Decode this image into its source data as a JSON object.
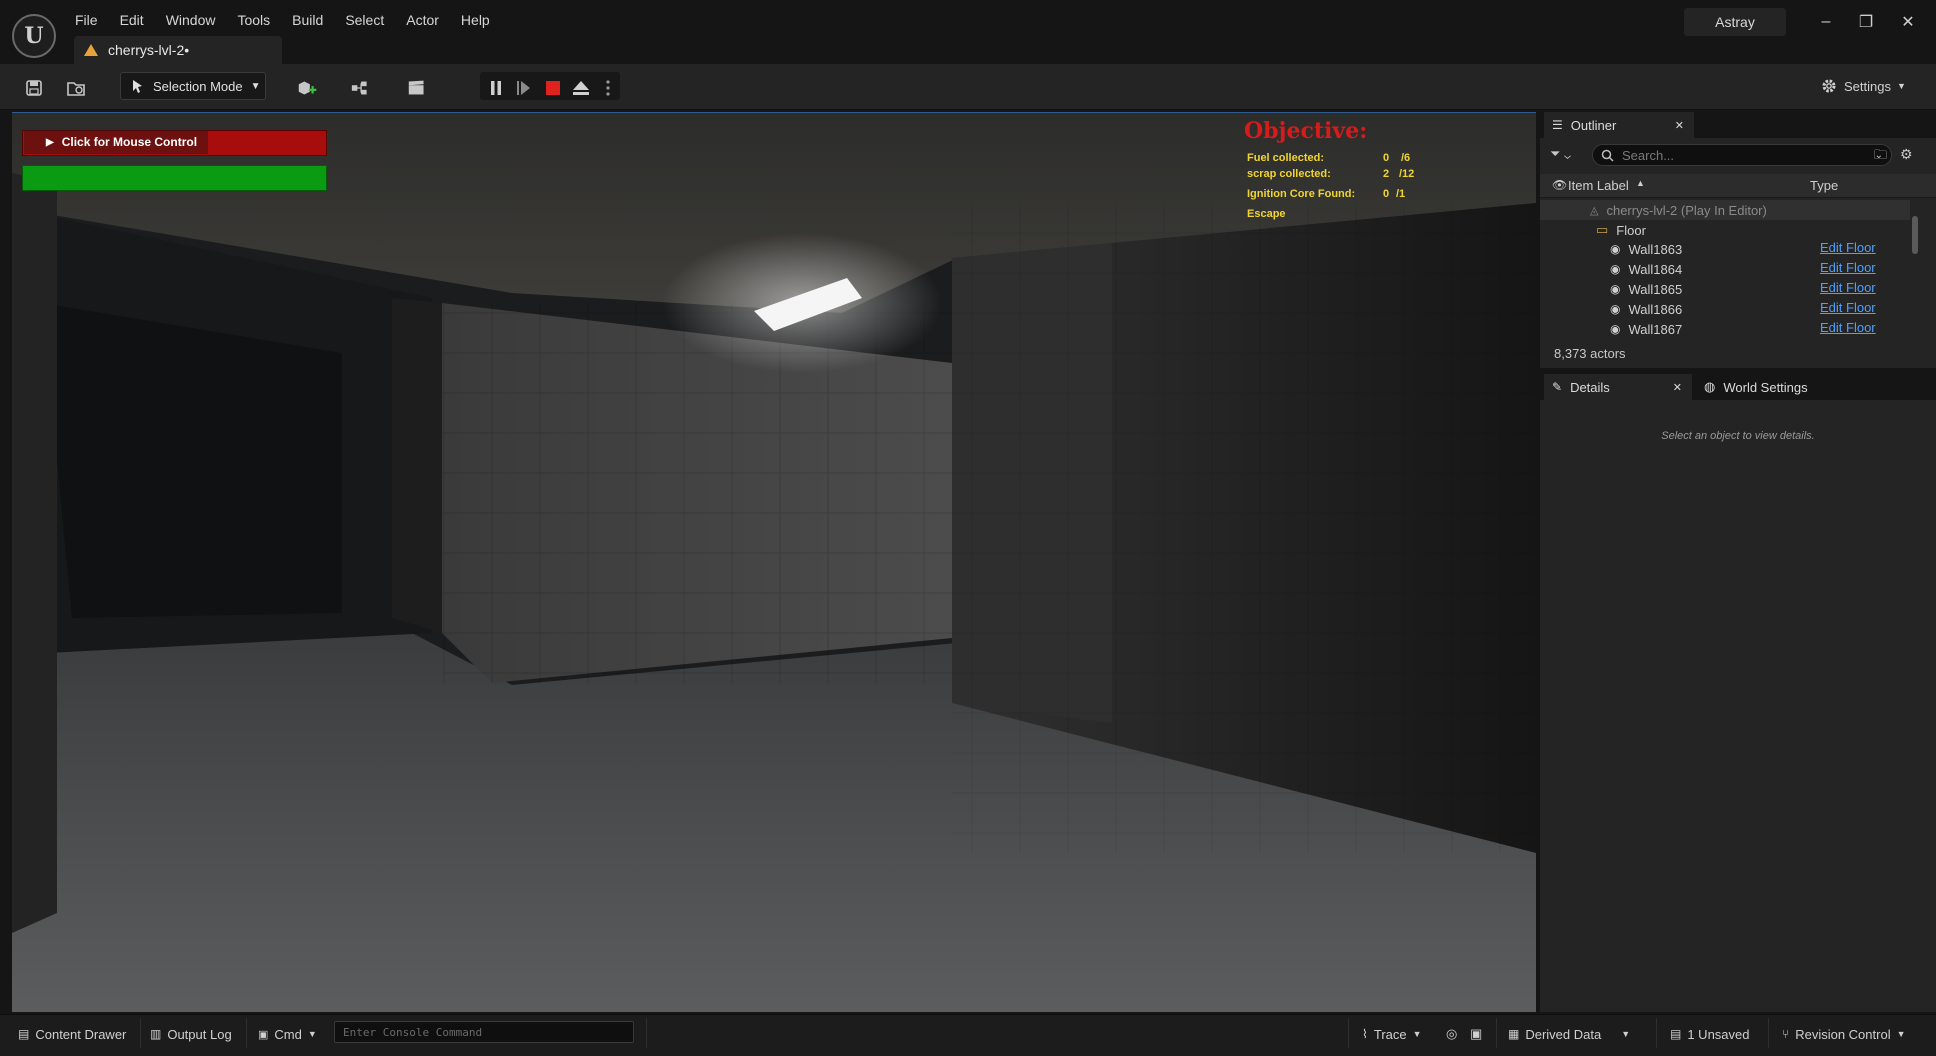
{
  "app": {
    "logo_glyph": "U",
    "project_name": "Astray",
    "level_tab": "cherrys-lvl-2•",
    "colors": {
      "accent_red": "#d71b1b",
      "hud_yellow": "#f0d531",
      "link_blue": "#4ea0ff",
      "health": "#a80d0d",
      "stamina": "#0b9b12"
    }
  },
  "menu": [
    "File",
    "Edit",
    "Window",
    "Tools",
    "Build",
    "Select",
    "Actor",
    "Help"
  ],
  "window_controls": {
    "minimize": "–",
    "restore": "❐",
    "close": "✕"
  },
  "toolbar": {
    "selection_mode": "Selection Mode",
    "settings": "Settings"
  },
  "hud": {
    "mouse_control": "Click for Mouse Control",
    "objective_title": "Objective:",
    "objectives": [
      {
        "label": "Fuel collected:",
        "count": "0",
        "total": "/6"
      },
      {
        "label": "scrap collected:",
        "count": "2",
        "total": "/12"
      },
      {
        "label": "Ignition Core Found:",
        "count": "0",
        "total": "/1"
      },
      {
        "label": "Escape",
        "count": "",
        "total": ""
      }
    ]
  },
  "outliner": {
    "tab": "Outliner",
    "search_placeholder": "Search...",
    "col_label": "Item Label",
    "col_type": "Type",
    "root": "cherrys-lvl-2 (Play In Editor)",
    "folder": "Floor",
    "rows": [
      {
        "name": "Wall1863",
        "type": "Edit Floor"
      },
      {
        "name": "Wall1864",
        "type": "Edit Floor"
      },
      {
        "name": "Wall1865",
        "type": "Edit Floor"
      },
      {
        "name": "Wall1866",
        "type": "Edit Floor"
      },
      {
        "name": "Wall1867",
        "type": "Edit Floor"
      }
    ],
    "actor_count": "8,373 actors"
  },
  "details": {
    "tab": "Details",
    "world_tab": "World Settings",
    "hint": "Select an object to view details."
  },
  "statusbar": {
    "content_drawer": "Content Drawer",
    "output_log": "Output Log",
    "cmd": "Cmd",
    "console_placeholder": "Enter Console Command",
    "trace": "Trace",
    "derived_data": "Derived Data",
    "unsaved": "1 Unsaved",
    "revision_control": "Revision Control"
  }
}
